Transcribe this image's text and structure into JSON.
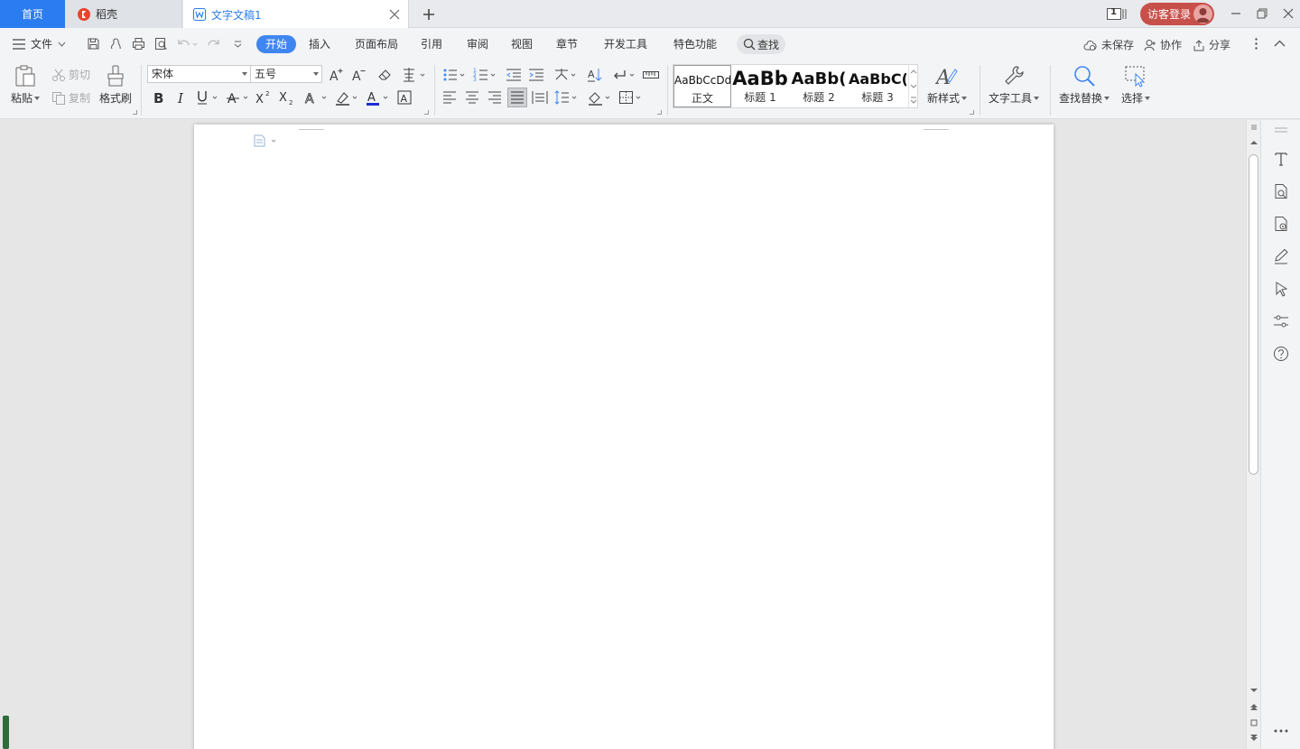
{
  "tabs": {
    "home": "首页",
    "daoke": "稻壳",
    "doc": "文字文稿1"
  },
  "window": {
    "count": "1",
    "login": "访客登录"
  },
  "menu": {
    "file": "文件",
    "tabs": [
      "开始",
      "插入",
      "页面布局",
      "引用",
      "审阅",
      "视图",
      "章节",
      "开发工具",
      "特色功能"
    ],
    "search": "查找",
    "unsaved": "未保存",
    "collab": "协作",
    "share": "分享"
  },
  "ribbon": {
    "paste": "粘贴",
    "cut": "剪切",
    "copy": "复制",
    "format_painter": "格式刷",
    "font_name": "宋体",
    "font_size": "五号",
    "styles": [
      {
        "sample": "AaBbCcDd",
        "name": "正文"
      },
      {
        "sample": "AaBb",
        "name": "标题 1"
      },
      {
        "sample": "AaBb(",
        "name": "标题 2"
      },
      {
        "sample": "AaBbC(",
        "name": "标题 3"
      }
    ],
    "new_style": "新样式",
    "text_tools": "文字工具",
    "find_replace": "查找替换",
    "select": "选择"
  },
  "colors": {
    "accent": "#2b7cf0",
    "login_bg": "#c8504a"
  }
}
